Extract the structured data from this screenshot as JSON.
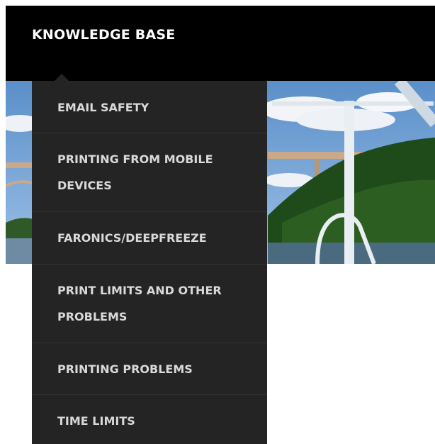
{
  "nav": {
    "title": "KNOWLEDGE BASE"
  },
  "dropdown": {
    "items": [
      {
        "label": "EMAIL SAFETY"
      },
      {
        "label": "PRINTING FROM MOBILE DEVICES"
      },
      {
        "label": "FARONICS/DEEPFREEZE"
      },
      {
        "label": "PRINT LIMITS AND OTHER PROBLEMS"
      },
      {
        "label": "PRINTING PROBLEMS"
      },
      {
        "label": "TIME LIMITS"
      }
    ]
  },
  "colors": {
    "navbar": "#000000",
    "dropdown_bg": "#242424",
    "dropdown_text": "#d9d9d9",
    "nav_text": "#ffffff"
  }
}
